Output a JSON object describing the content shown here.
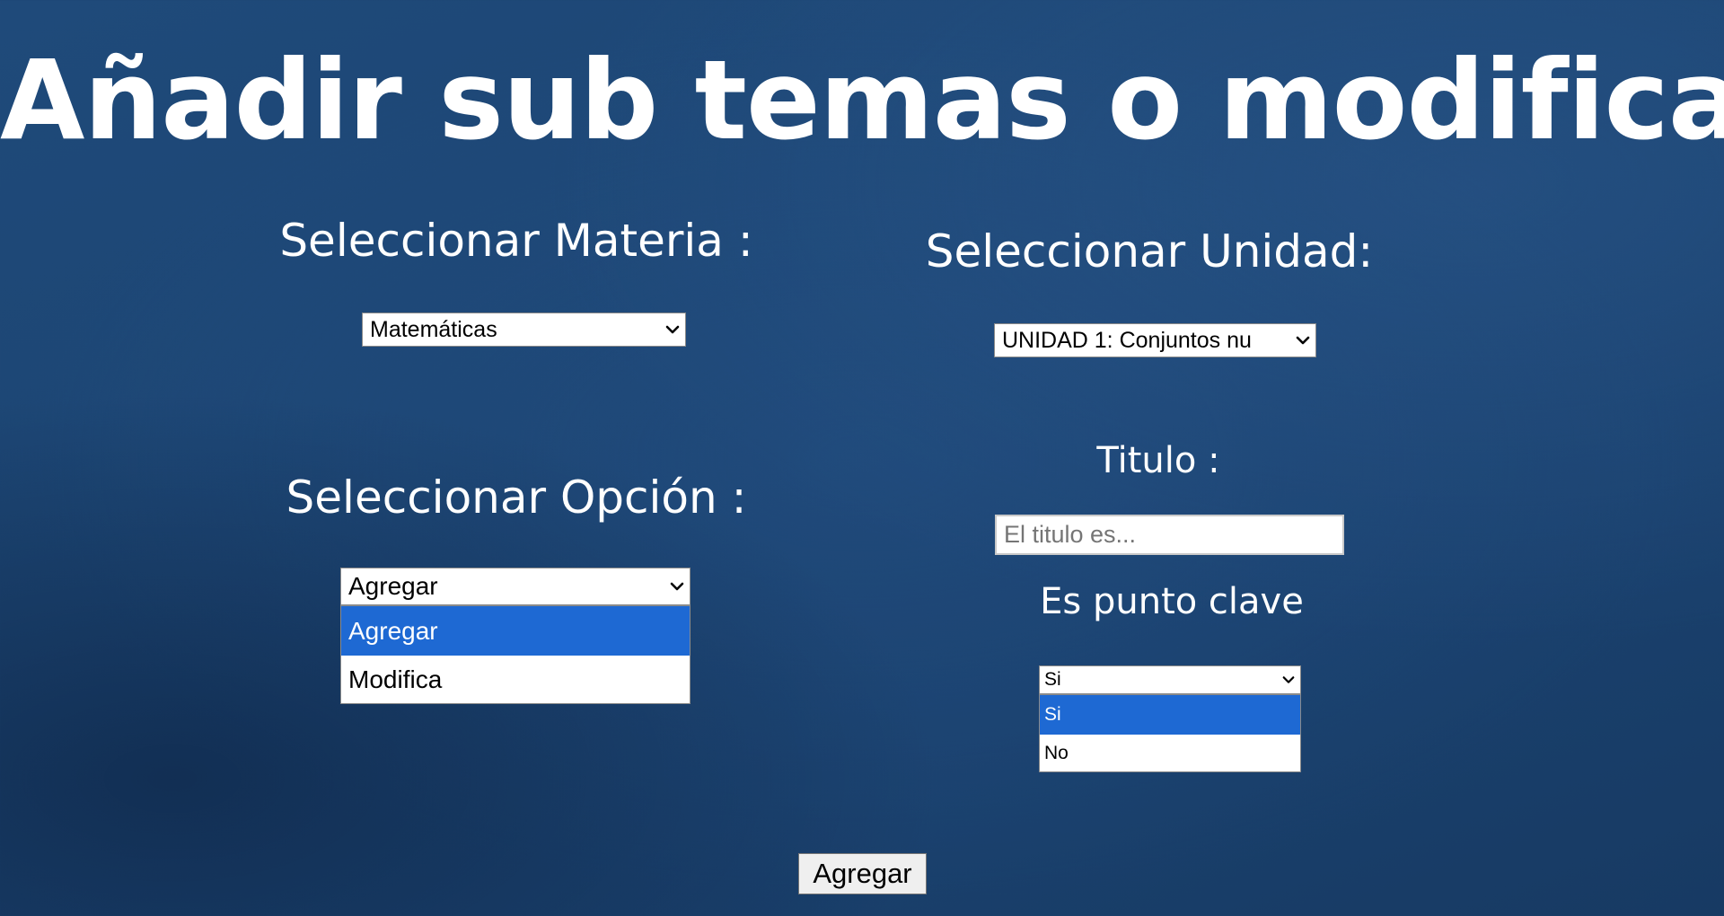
{
  "page": {
    "title": "Añadir sub temas o modificar"
  },
  "materia": {
    "label": "Seleccionar Materia :",
    "selected": "Matemáticas"
  },
  "unidad": {
    "label": "Seleccionar Unidad:",
    "selected": "UNIDAD 1: Conjuntos nu"
  },
  "opcion": {
    "label": "Seleccionar Opción :",
    "selected": "Agregar",
    "options": [
      "Agregar",
      "Modifica"
    ],
    "highlighted_index": 0
  },
  "titulo": {
    "label": "Titulo :",
    "placeholder": "El titulo es...",
    "value": ""
  },
  "punto_clave": {
    "label": "Es punto clave",
    "selected": "Si",
    "options": [
      "Si",
      "No"
    ],
    "highlighted_index": 0
  },
  "submit": {
    "label": "Agregar"
  },
  "colors": {
    "background": "#1c4573",
    "option_highlight": "#1e69d3",
    "button_bg": "#efefef"
  },
  "icons": {
    "select_arrow": "chevron-down-icon"
  }
}
